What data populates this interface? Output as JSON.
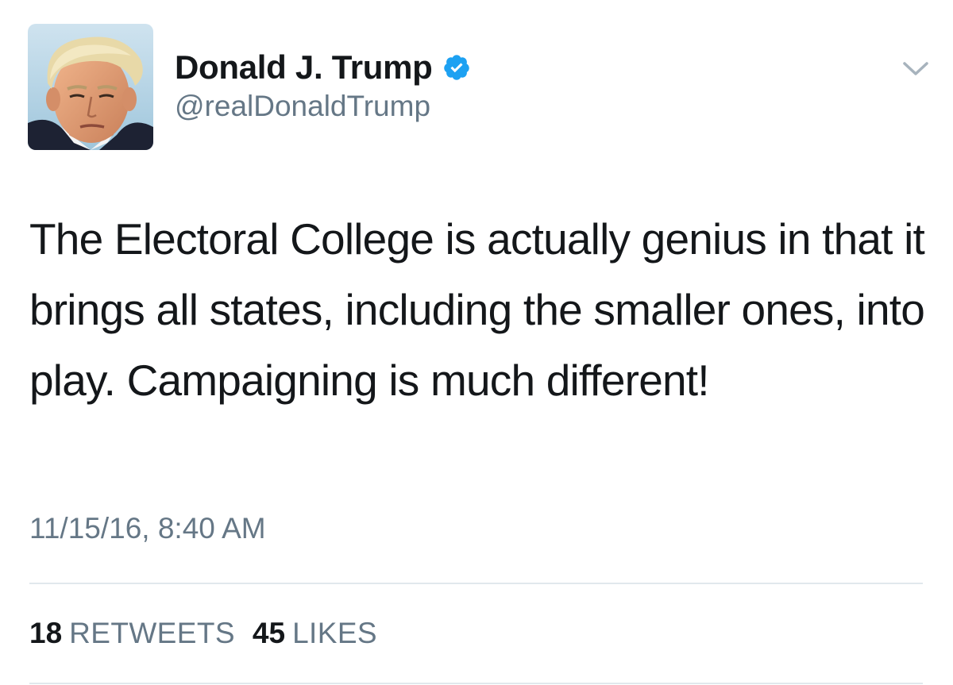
{
  "author": {
    "display_name": "Donald J. Trump",
    "handle": "@realDonaldTrump",
    "verified": true,
    "avatar_icon": "profile-photo"
  },
  "tweet": {
    "text": "The Electoral College is actually genius in that it brings all states, including the smaller ones, into play. Campaigning is much different!",
    "timestamp": "11/15/16, 8:40 AM"
  },
  "stats": {
    "retweets_count": "18",
    "retweets_label": "RETWEETS",
    "likes_count": "45",
    "likes_label": "LIKES"
  },
  "colors": {
    "verified_badge": "#1da1f2",
    "secondary_text": "#657786",
    "primary_text": "#14171a",
    "divider": "#e1e8ed"
  },
  "icons": {
    "verified": "verified-badge-icon",
    "menu": "chevron-down-icon"
  }
}
